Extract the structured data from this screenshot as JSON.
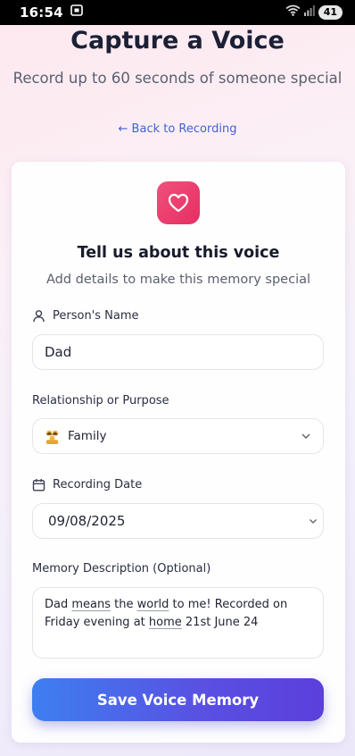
{
  "status_bar": {
    "time": "16:54",
    "battery": "41"
  },
  "header": {
    "title": "Capture a Voice",
    "subtitle": "Record up to 60 seconds of someone special",
    "back_link": "← Back to Recording"
  },
  "card": {
    "title": "Tell us about this voice",
    "subtitle": "Add details to make this memory special",
    "name_field": {
      "label": "Person's Name",
      "value": "Dad"
    },
    "relationship_field": {
      "label": "Relationship or Purpose",
      "value": "Family",
      "emoji": "family"
    },
    "date_field": {
      "label": "Recording Date",
      "value": "09/08/2025"
    },
    "description_field": {
      "label": "Memory Description (Optional)",
      "text_parts": [
        "Dad ",
        "means",
        " the ",
        "world",
        " to me! Recorded on Friday evening at ",
        "home",
        " 21st June 24"
      ]
    },
    "save_button": "Save Voice Memory"
  },
  "colors": {
    "accent_blue": "#3f63d6",
    "heart_badge": "#e62e63",
    "button_start": "#3e7ff0",
    "button_end": "#5b3fdc"
  }
}
